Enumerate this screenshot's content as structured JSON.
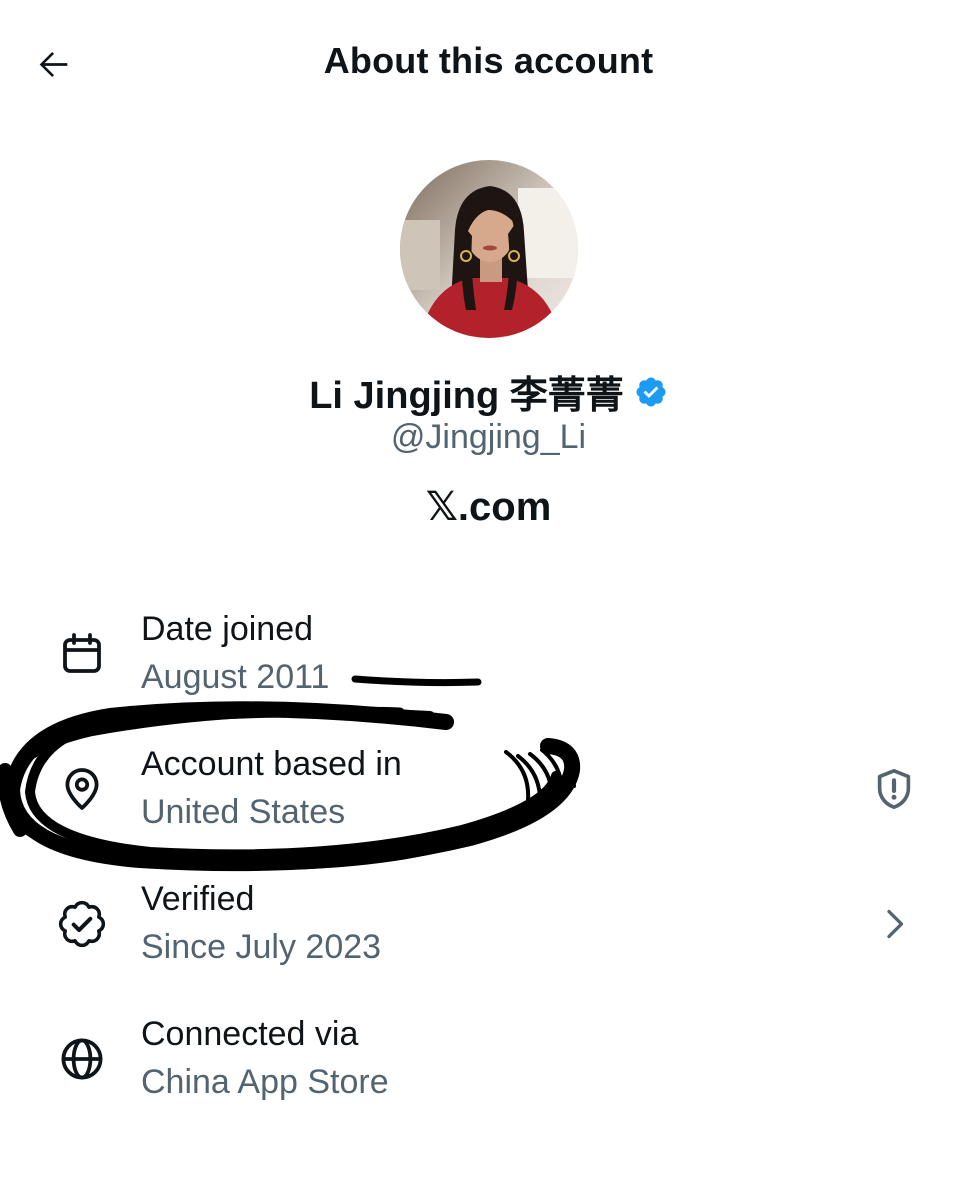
{
  "header": {
    "title": "About this account",
    "back_icon": "arrow-left-icon"
  },
  "profile": {
    "display_name": "Li Jingjing 李菁菁",
    "handle": "@Jingjing_Li",
    "verified_badge_color": "#1d9bf0",
    "brand": "𝕏.com"
  },
  "details": {
    "date_joined": {
      "label": "Date joined",
      "value": "August 2011",
      "icon": "calendar-icon"
    },
    "based_in": {
      "label": "Account based in",
      "value": "United States",
      "icon": "location-pin-icon",
      "right_icon": "shield-alert-icon"
    },
    "verified": {
      "label": "Verified",
      "value": "Since July 2023",
      "icon": "verified-badge-icon",
      "right_icon": "chevron-right-icon"
    },
    "connected_via": {
      "label": "Connected via",
      "value": "China App Store",
      "icon": "globe-icon"
    }
  },
  "colors": {
    "text_primary": "#0f1419",
    "text_secondary": "#536471",
    "accent": "#1d9bf0",
    "background": "#ffffff"
  }
}
